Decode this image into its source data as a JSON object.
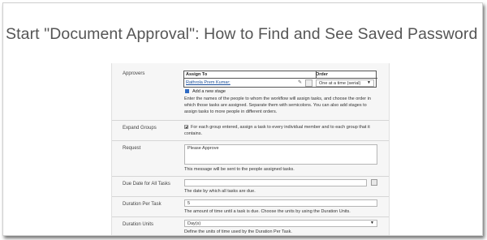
{
  "title": "Start \"Document Approval\": How to Find and See Saved Password in the C",
  "approvers": {
    "label": "Approvers",
    "assign_to_header": "Assign To",
    "order_header": "Order",
    "assignee": "Rathrola Prem Kumar;",
    "order_value": "One at a time (serial)",
    "add_stage": "Add a new stage",
    "help": "Enter the names of the people to whom the workflow will assign tasks, and choose the order in which those tasks are assigned. Separate them with semicolons. You can also add stages to assign tasks to more people in different orders."
  },
  "expand_groups": {
    "label": "Expand Groups",
    "checked": true,
    "text": "For each group entered, assign a task to every individual member and to each group that it contains."
  },
  "request": {
    "label": "Request",
    "value": "Please Approve",
    "help": "This message will be sent to the people assigned tasks."
  },
  "due_date": {
    "label": "Due Date for All Tasks",
    "value": "",
    "help": "The date by which all tasks are due."
  },
  "duration_per_task": {
    "label": "Duration Per Task",
    "value": "5",
    "help": "The amount of time until a task is due. Choose the units by using the Duration Units."
  },
  "duration_units": {
    "label": "Duration Units",
    "value": "Day(s)",
    "help": "Define the units of time used by the Duration Per Task."
  }
}
